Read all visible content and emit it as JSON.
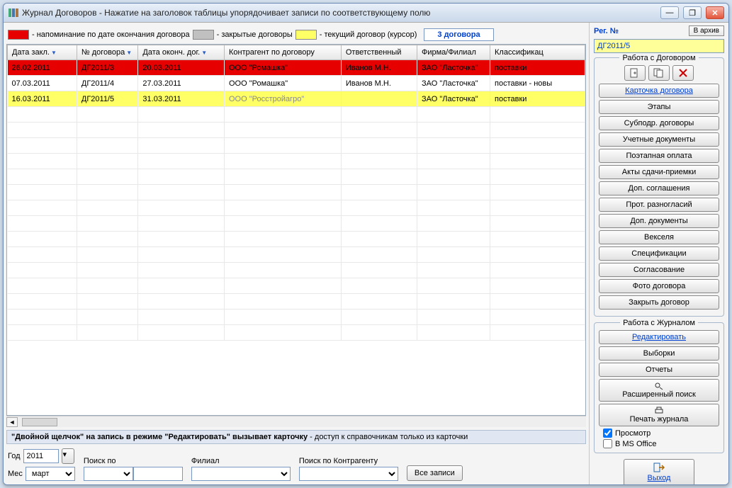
{
  "title": "Журнал Договоров   -   Нажатие на заголовок таблицы упорядочивает записи по соответствующему полю",
  "legend": {
    "red": "- напоминание по дате окончания договора",
    "gray": "- закрытые договоры",
    "yellow": "- текущий договор (курсор)",
    "count": "3 договора"
  },
  "columns": [
    "Дата закл.",
    "№ договора",
    "Дата оконч. дог.",
    "Контрагент по договору",
    "Ответственный",
    "Фирма/Филиал",
    "Классификац"
  ],
  "rows": [
    {
      "state": "red",
      "cells": [
        "26.02.2011",
        "ДГ2011/3",
        "20.03.2011",
        "ООО \"Ромашка\"",
        "Иванов М.Н.",
        "ЗАО \"Ласточка\"",
        "поставки"
      ]
    },
    {
      "state": "",
      "cells": [
        "07.03.2011",
        "ДГ2011/4",
        "27.03.2011",
        "ООО \"Ромашка\"",
        "Иванов М.Н.",
        "ЗАО \"Ласточка\"",
        "поставки - новы"
      ]
    },
    {
      "state": "yellow",
      "cells": [
        "16.03.2011",
        "ДГ2011/5",
        "31.03.2011",
        "ООО \"Росстройагро\"",
        "",
        "ЗАО \"Ласточка\"",
        "поставки"
      ]
    }
  ],
  "hint": {
    "bold": "\"Двойной щелчок\" на запись в режиме \"Редактировать\" вызывает карточку",
    "sub": "  -  доступ к справочникам только из карточки"
  },
  "filters": {
    "year_label": "Год",
    "year": "2011",
    "month_label": "Мес",
    "month": "март",
    "search_label": "Поиск по",
    "branch_label": "Филиал",
    "counterparty_label": "Поиск по Контрагенту",
    "all_btn": "Все записи"
  },
  "reg": {
    "label": "Рег. №",
    "archive": "В архив",
    "value": "ДГ2011/5"
  },
  "group1": {
    "title": "Работа с Договором",
    "buttons": [
      "Карточка договора",
      "Этапы",
      "Субподр. договоры",
      "Учетные документы",
      "Поэтапная оплата",
      "Акты сдачи-приемки",
      "Доп. соглашения",
      "Прот. разногласий",
      "Доп. документы",
      "Векселя",
      "Спецификации",
      "Согласование",
      "Фото договора",
      "Закрыть договор"
    ]
  },
  "group2": {
    "title": "Работа с Журналом",
    "buttons": [
      "Редактировать",
      "Выборки",
      "Отчеты",
      "Расширенный поиск",
      "Печать журнала"
    ],
    "preview": "Просмотр",
    "msoffice": "В MS Office"
  },
  "exit": "Выход"
}
